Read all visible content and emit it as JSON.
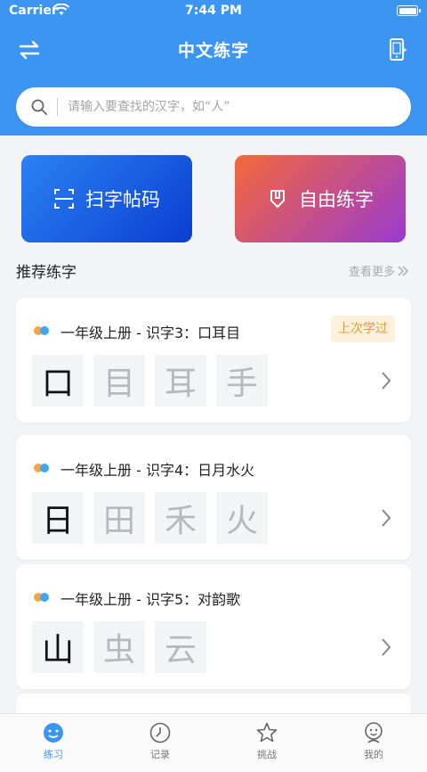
{
  "status_bar": {
    "carrier": "Carrier",
    "time": "7:44 PM"
  },
  "nav": {
    "title": "中文练字",
    "left_icon": "swap-icon",
    "right_icon": "phone-icon"
  },
  "search": {
    "value": "",
    "placeholder": "请输入要查找的汉字，如“人”"
  },
  "actions": [
    {
      "label": "扫字帖码",
      "icon": "scan-icon"
    },
    {
      "label": "自由练字",
      "icon": "pen-shield-icon"
    }
  ],
  "section": {
    "title": "推荐练字",
    "more_label": "查看更多"
  },
  "cards": [
    {
      "title": "一年级上册 - 识字3：口耳目",
      "badge": "上次学过",
      "chars": [
        "口",
        "目",
        "耳",
        "手"
      ]
    },
    {
      "title": "一年级上册 - 识字4：日月水火",
      "badge": "",
      "chars": [
        "日",
        "田",
        "禾",
        "火"
      ]
    },
    {
      "title": "一年级上册 - 识字5：对韵歌",
      "badge": "",
      "chars": [
        "山",
        "虫",
        "云"
      ]
    }
  ],
  "tabs": [
    {
      "label": "练习",
      "icon": "practice-icon",
      "active": true
    },
    {
      "label": "记录",
      "icon": "clock-icon",
      "active": false
    },
    {
      "label": "挑战",
      "icon": "star-icon",
      "active": false
    },
    {
      "label": "我的",
      "icon": "profile-icon",
      "active": false
    }
  ],
  "colors": {
    "primary": "#3d95f2",
    "scan_gradient": [
      "#2c82f5",
      "#0a3fd0"
    ],
    "free_gradient": [
      "#f5683a",
      "#9b3ad0"
    ],
    "badge_bg": "#fdf1dc",
    "badge_text": "#e39a3a"
  }
}
